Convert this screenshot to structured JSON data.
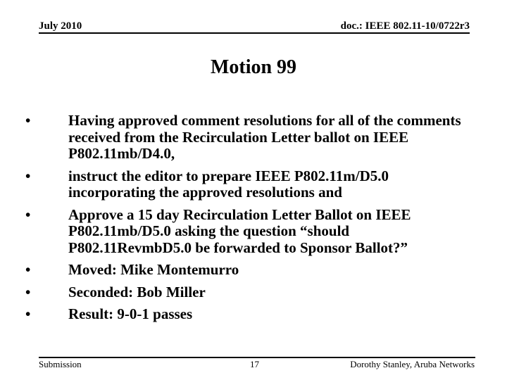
{
  "header": {
    "date": "July 2010",
    "doc_id": "doc.: IEEE 802.11-10/0722r3"
  },
  "slide": {
    "title": "Motion 99",
    "bullets": [
      {
        "icon": "bullet-dot",
        "text": "Having approved comment resolutions for all of the comments received from the Recirculation Letter ballot on IEEE P802.11mb/D4.0,"
      },
      {
        "icon": "bullet-dot",
        "text": "instruct the editor to prepare IEEE P802.11m/D5.0 incorporating the approved resolutions and"
      },
      {
        "icon": "bullet-dot",
        "text": "Approve a 15 day Recirculation Letter Ballot on IEEE P802.11mb/D5.0 asking the question “should P802.11RevmbD5.0 be forwarded to Sponsor Ballot?”"
      },
      {
        "icon": "bullet-dot",
        "text": "Moved: Mike Montemurro"
      },
      {
        "icon": "bullet-dot",
        "text": "Seconded: Bob Miller"
      },
      {
        "icon": "bullet-dot",
        "text": "Result: 9-0-1 passes"
      }
    ]
  },
  "footer": {
    "left": "Submission",
    "page_number": "17",
    "author": "Dorothy Stanley, Aruba Networks"
  },
  "bullet_glyph": "•"
}
